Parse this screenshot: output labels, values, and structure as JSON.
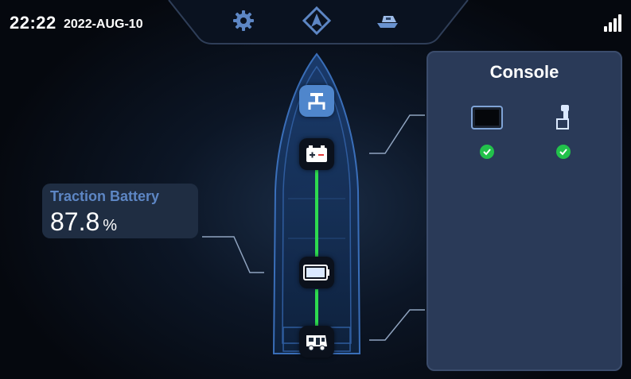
{
  "status_bar": {
    "time": "22:22",
    "date": "2022-AUG-10",
    "signal_icon": "signal-bars-icon"
  },
  "top_nav": {
    "items": [
      {
        "name": "settings",
        "icon": "gear-icon"
      },
      {
        "name": "navigation",
        "icon": "navigation-arrow-icon"
      },
      {
        "name": "boat",
        "icon": "boat-icon"
      }
    ]
  },
  "battery_card": {
    "title": "Traction Battery",
    "value": "87.8",
    "unit": "%"
  },
  "console": {
    "title": "Console",
    "devices": [
      {
        "icon": "display-screen-icon",
        "status": "ok"
      },
      {
        "icon": "throttle-lever-icon",
        "status": "ok"
      }
    ]
  },
  "colors": {
    "accent_blue": "#5d86c4",
    "status_green": "#22c14b",
    "flow_green": "#2edb4f",
    "panel_bg": "#2a3a58"
  }
}
